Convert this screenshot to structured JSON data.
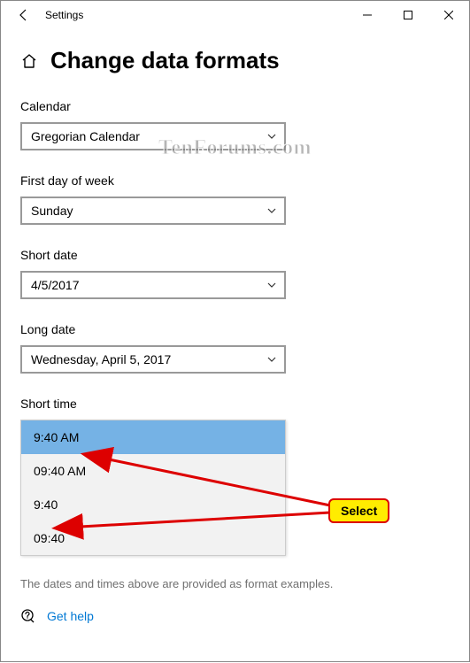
{
  "window": {
    "app_title": "Settings"
  },
  "page": {
    "title": "Change data formats",
    "footnote": "The dates and times above are provided as format examples.",
    "help_link": "Get help"
  },
  "fields": {
    "calendar": {
      "label": "Calendar",
      "value": "Gregorian Calendar"
    },
    "first_day": {
      "label": "First day of week",
      "value": "Sunday"
    },
    "short_date": {
      "label": "Short date",
      "value": "4/5/2017"
    },
    "long_date": {
      "label": "Long date",
      "value": "Wednesday, April 5, 2017"
    },
    "short_time": {
      "label": "Short time",
      "options": [
        "9:40 AM",
        "09:40 AM",
        "9:40",
        "09:40"
      ],
      "selected_index": 0
    }
  },
  "annotation": {
    "badge": "Select"
  },
  "watermark": "TenForums.com"
}
